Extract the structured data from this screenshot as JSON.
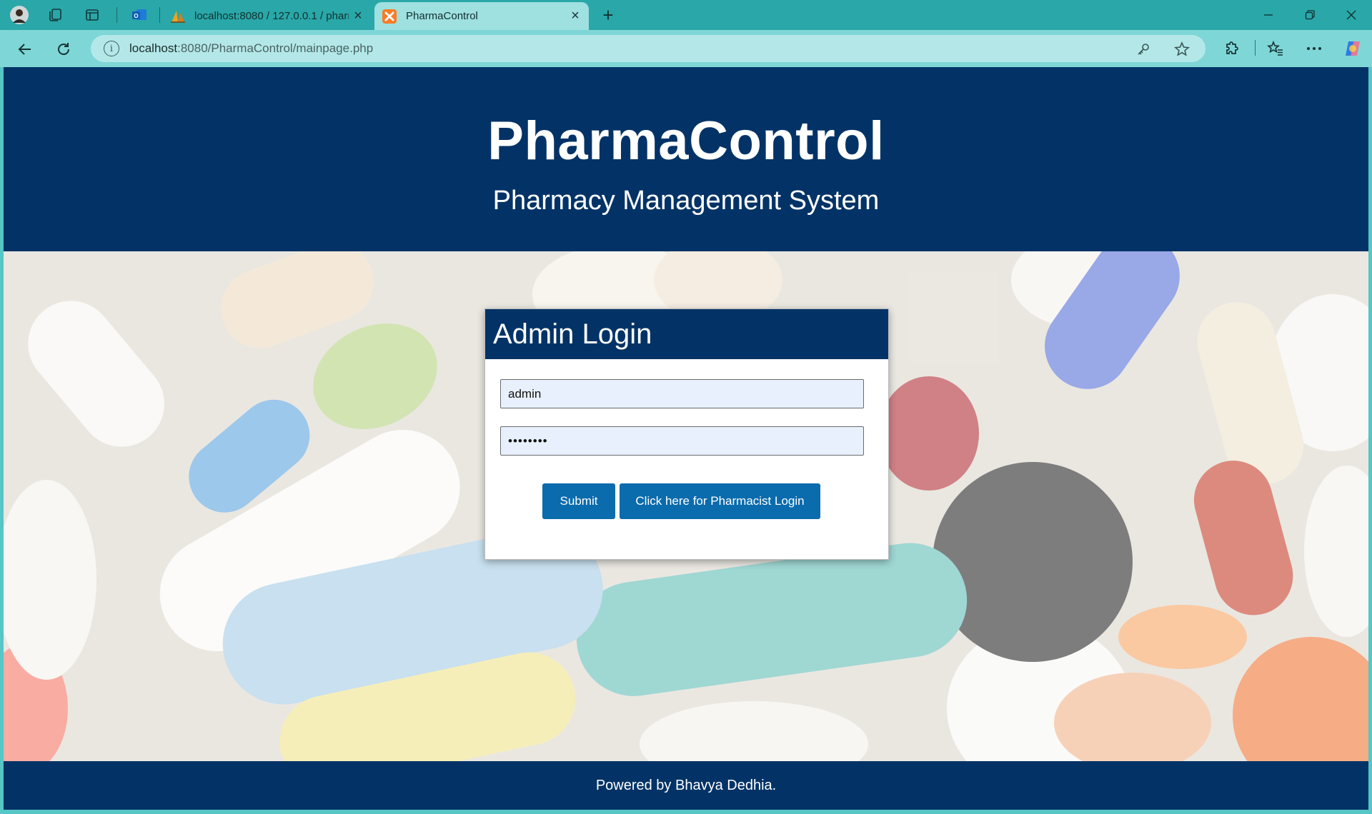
{
  "browser": {
    "tabs": [
      {
        "title": "localhost:8080 / 127.0.0.1 / pharm",
        "favicon": "phpmyadmin-sail-icon"
      },
      {
        "title": "PharmaControl",
        "favicon": "xampp-icon"
      }
    ],
    "address": {
      "host": "localhost",
      "path": ":8080/PharmaControl/mainpage.php"
    }
  },
  "header": {
    "title": "PharmaControl",
    "subtitle": "Pharmacy Management System"
  },
  "login": {
    "heading": "Admin Login",
    "username_value": "admin",
    "password_value": "••••••••",
    "submit_label": "Submit",
    "pharmacist_link_label": "Click here for Pharmacist Login"
  },
  "footer": {
    "text": "Powered by Bhavya Dedhia."
  },
  "colors": {
    "brand_navy": "#033366",
    "button_blue": "#0a6bad",
    "browser_teal": "#2aa7a8"
  }
}
